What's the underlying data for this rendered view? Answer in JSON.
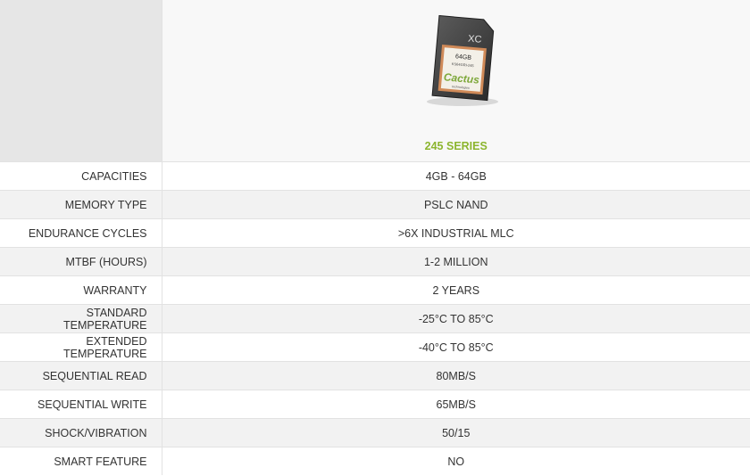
{
  "header": {
    "series_title": "245 SERIES",
    "series_color": "#8cb52e",
    "image": {
      "icon": "sd-card-image",
      "card_text": {
        "type_mark": "XC",
        "capacity": "64GB",
        "part_number": "KS64GRI-245",
        "brand": "Cactus",
        "brand_tagline": "technologies"
      }
    }
  },
  "specs": [
    {
      "label": "CAPACITIES",
      "value": "4GB - 64GB"
    },
    {
      "label": "MEMORY TYPE",
      "value": "PSLC NAND"
    },
    {
      "label": "ENDURANCE CYCLES",
      "value": ">6X INDUSTRIAL MLC"
    },
    {
      "label": "MTBF (HOURS)",
      "value": "1-2 MILLION"
    },
    {
      "label": "WARRANTY",
      "value": "2 YEARS"
    },
    {
      "label": "STANDARD TEMPERATURE",
      "value": "-25°C TO 85°C"
    },
    {
      "label": "EXTENDED TEMPERATURE",
      "value": "-40°C TO 85°C"
    },
    {
      "label": "SEQUENTIAL READ",
      "value": "80MB/S"
    },
    {
      "label": "SEQUENTIAL WRITE",
      "value": "65MB/S"
    },
    {
      "label": "SHOCK/VIBRATION",
      "value": "50/15"
    },
    {
      "label": "SMART FEATURE",
      "value": "NO"
    }
  ]
}
